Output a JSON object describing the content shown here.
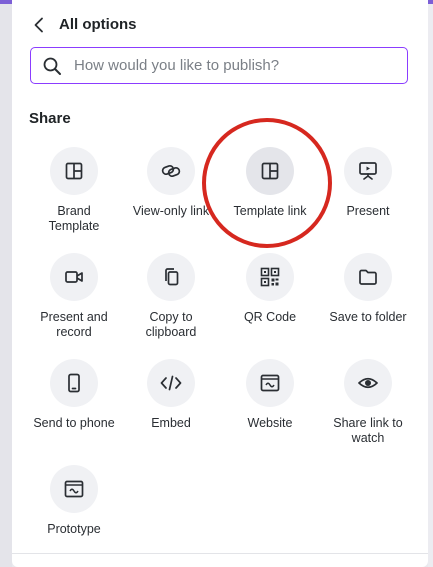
{
  "header": {
    "title": "All options",
    "back_icon": "chevron-left-icon"
  },
  "search": {
    "placeholder": "How would you like to publish?",
    "value": ""
  },
  "share": {
    "title": "Share",
    "items": [
      {
        "label": "Brand\nTemplate",
        "icon": "brand-template-icon"
      },
      {
        "label": "View-only link",
        "icon": "link-icon"
      },
      {
        "label": "Template link",
        "icon": "template-link-icon"
      },
      {
        "label": "Present",
        "icon": "present-icon"
      },
      {
        "label": "Present and\nrecord",
        "icon": "video-camera-icon"
      },
      {
        "label": "Copy to\nclipboard",
        "icon": "copy-icon"
      },
      {
        "label": "QR Code",
        "icon": "qr-code-icon"
      },
      {
        "label": "Save to folder",
        "icon": "folder-icon"
      },
      {
        "label": "Send to phone",
        "icon": "phone-icon"
      },
      {
        "label": "Embed",
        "icon": "embed-code-icon"
      },
      {
        "label": "Website",
        "icon": "website-icon"
      },
      {
        "label": "Share link to\nwatch",
        "icon": "eye-icon"
      },
      {
        "label": "Prototype",
        "icon": "prototype-icon"
      }
    ]
  },
  "colors": {
    "accent": "#8b3dff",
    "highlight_ring": "#d6281f",
    "icon_bg": "#f0f1f4"
  }
}
